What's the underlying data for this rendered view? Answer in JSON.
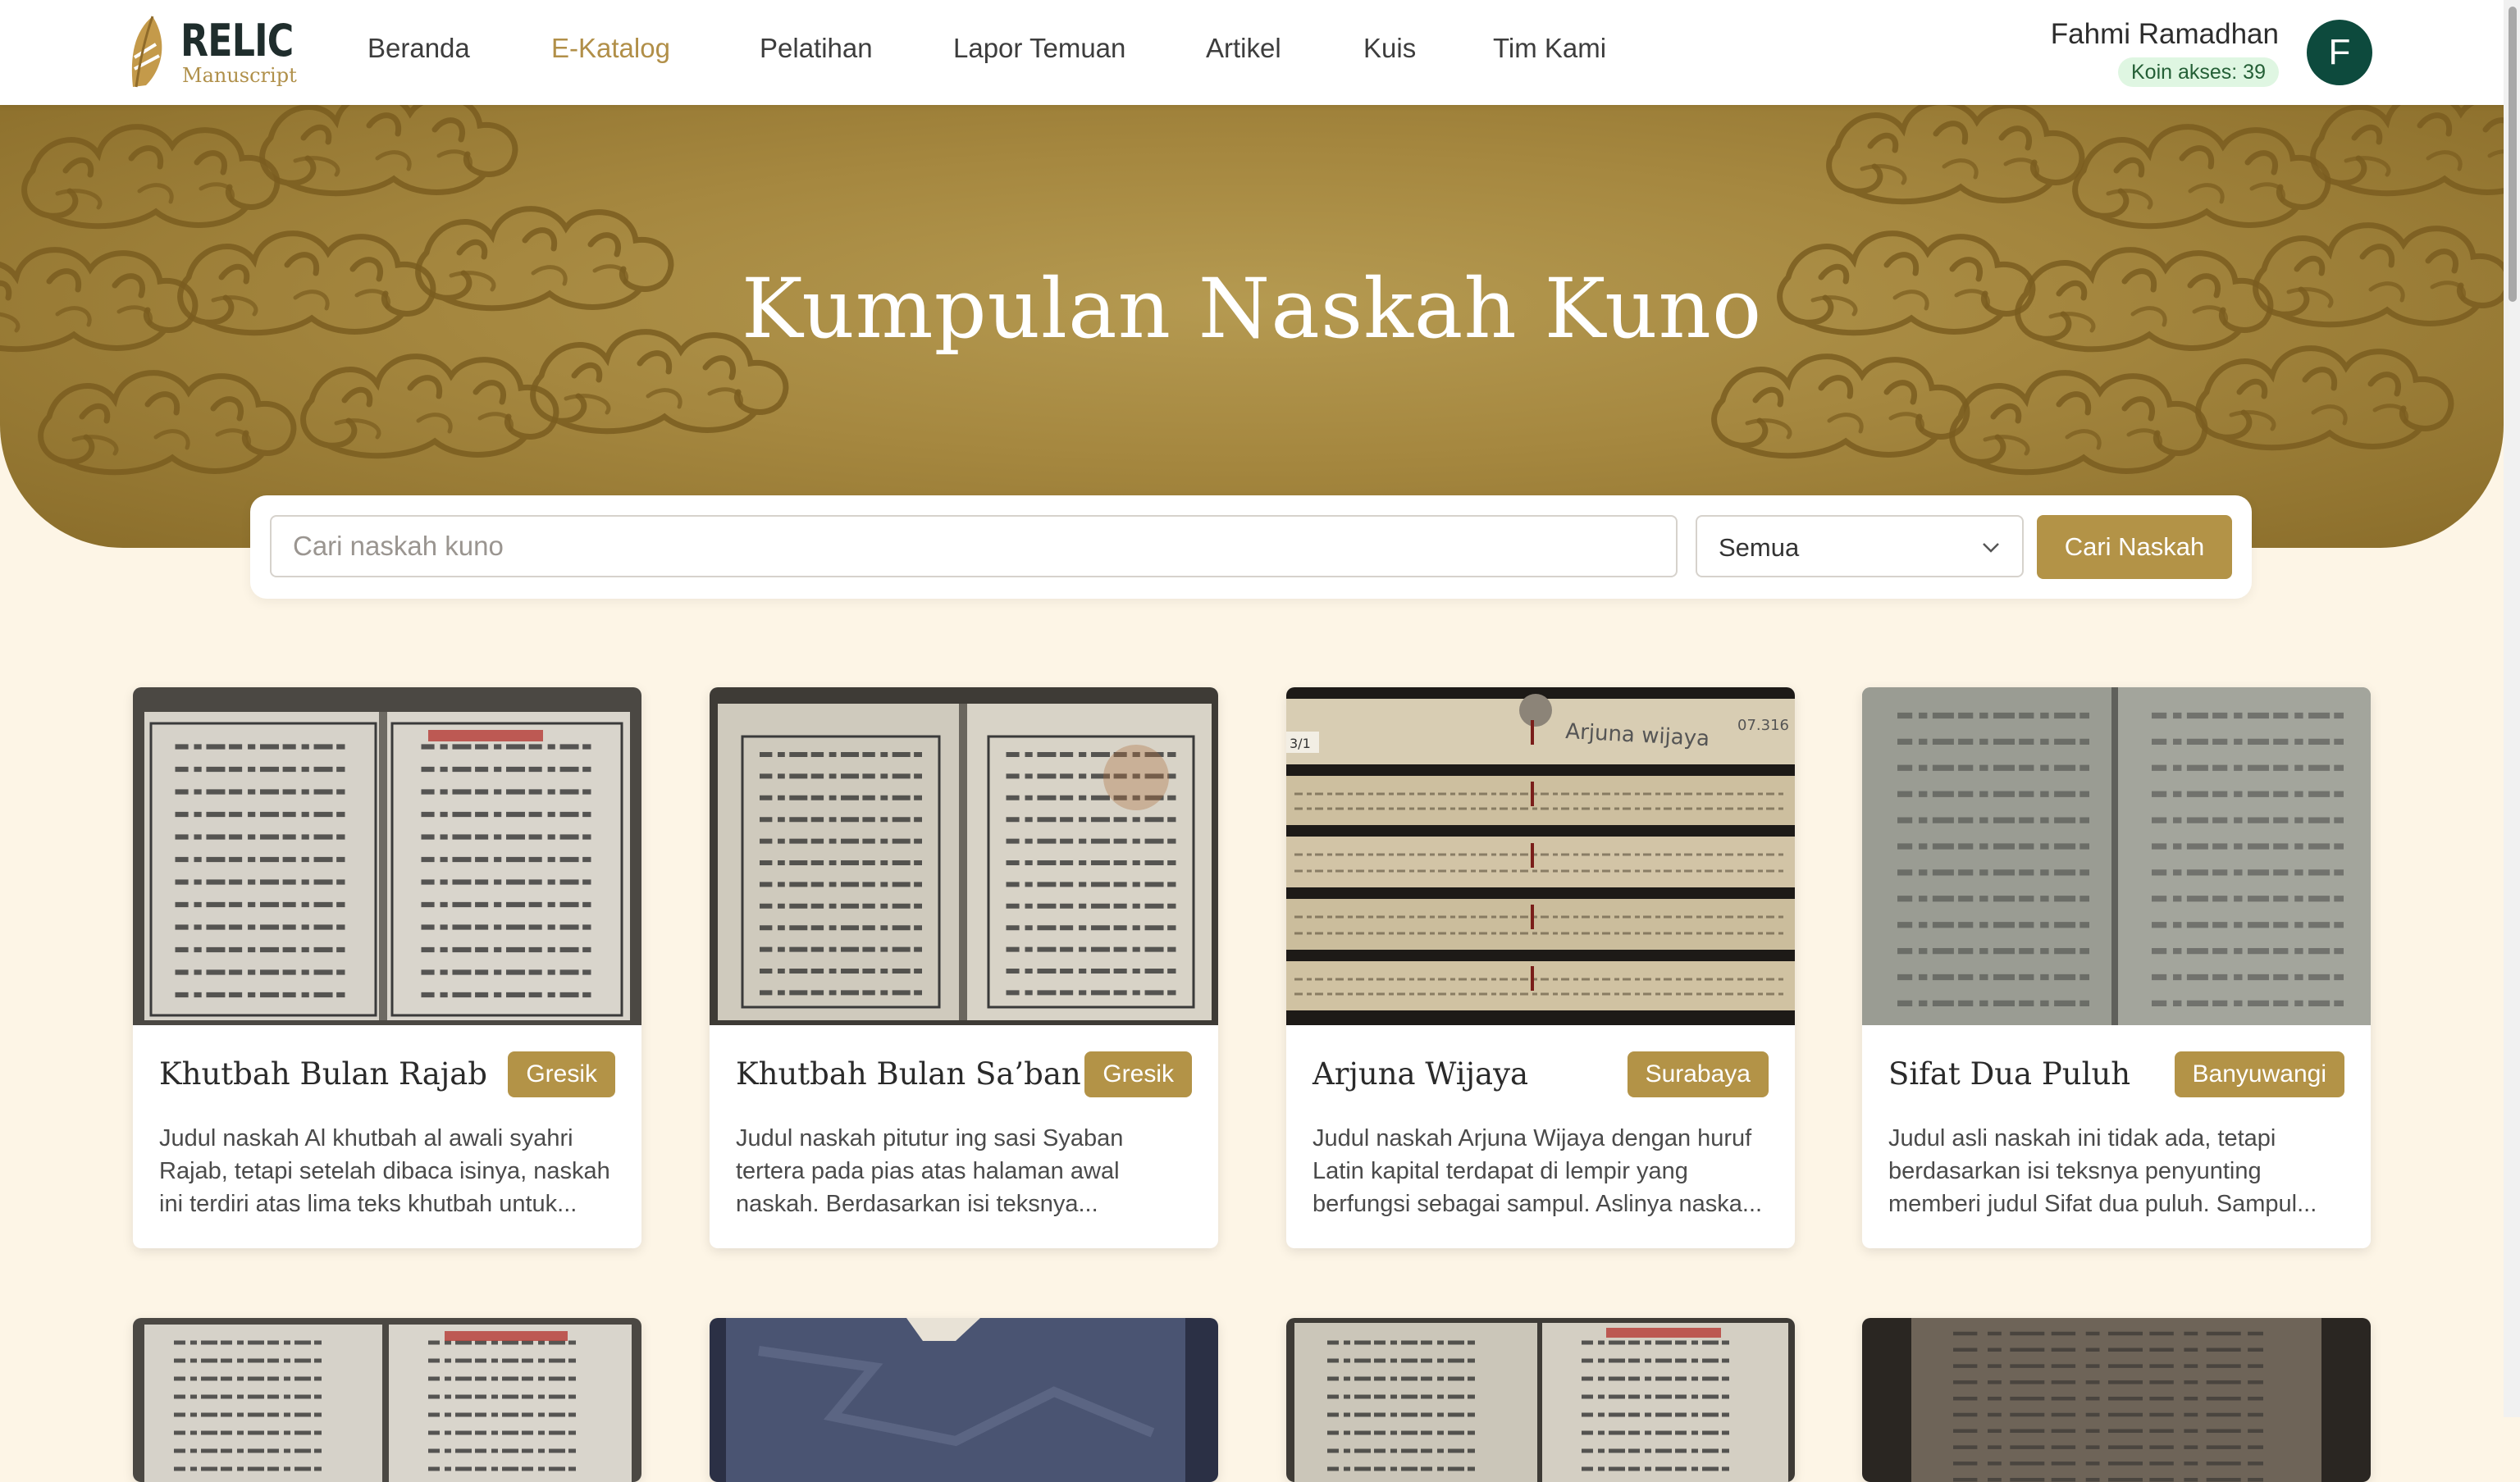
{
  "brand": {
    "title": "RELIC",
    "subtitle": "Manuscript"
  },
  "nav": {
    "items": [
      {
        "label": "Beranda",
        "active": false
      },
      {
        "label": "E-Katalog",
        "active": true
      },
      {
        "label": "Pelatihan",
        "active": false
      },
      {
        "label": "Lapor Temuan",
        "active": false
      },
      {
        "label": "Artikel",
        "active": false
      },
      {
        "label": "Kuis",
        "active": false
      },
      {
        "label": "Tim Kami",
        "active": false
      }
    ]
  },
  "user": {
    "name": "Fahmi Ramadhan",
    "coins_text": "Koin akses: 39",
    "avatar_letter": "F"
  },
  "hero": {
    "title": "Kumpulan Naskah Kuno"
  },
  "search": {
    "placeholder": "Cari naskah kuno",
    "value": "",
    "filter_selected": "Semua",
    "button_label": "Cari Naskah"
  },
  "cards": [
    {
      "title": "Khutbah Bulan Rajab",
      "region": "Gresik",
      "description": "Judul naskah Al khutbah al awali syahri Rajab, tetapi setelah dibaca isinya, naskah ini terdiri atas lima teks khutbah untuk...",
      "image": "open-manuscript-red-heading"
    },
    {
      "title": "Khutbah Bulan Sa’ban",
      "region": "Gresik",
      "description": "Judul naskah pitutur ing sasi Syaban tertera pada pias atas halaman awal naskah. Berdasarkan isi teksnya...",
      "image": "open-manuscript-stained"
    },
    {
      "title": "Arjuna Wijaya",
      "region": "Surabaya",
      "description": "Judul naskah Arjuna Wijaya dengan huruf Latin kapital terdapat di lempir yang berfungsi sebagai sampul. Aslinya naska...",
      "image": "palm-leaf-manuscript"
    },
    {
      "title": "Sifat Dua Puluh",
      "region": "Banyuwangi",
      "description": "Judul asli naskah ini tidak ada, tetapi berdasarkan isi teksnya penyunting memberi judul Sifat dua puluh. Sampul...",
      "image": "faded-manuscript"
    }
  ],
  "cards_row2_images": [
    "open-manuscript-red-heading",
    "blue-cover",
    "open-manuscript-dark-edges",
    "dark-script-page"
  ],
  "colors": {
    "accent": "#b39347",
    "nav_active": "#b18f48",
    "page_bg": "#fdf5e6",
    "avatar_bg": "#0d4a3d",
    "coin_bg": "#dff6e2"
  }
}
